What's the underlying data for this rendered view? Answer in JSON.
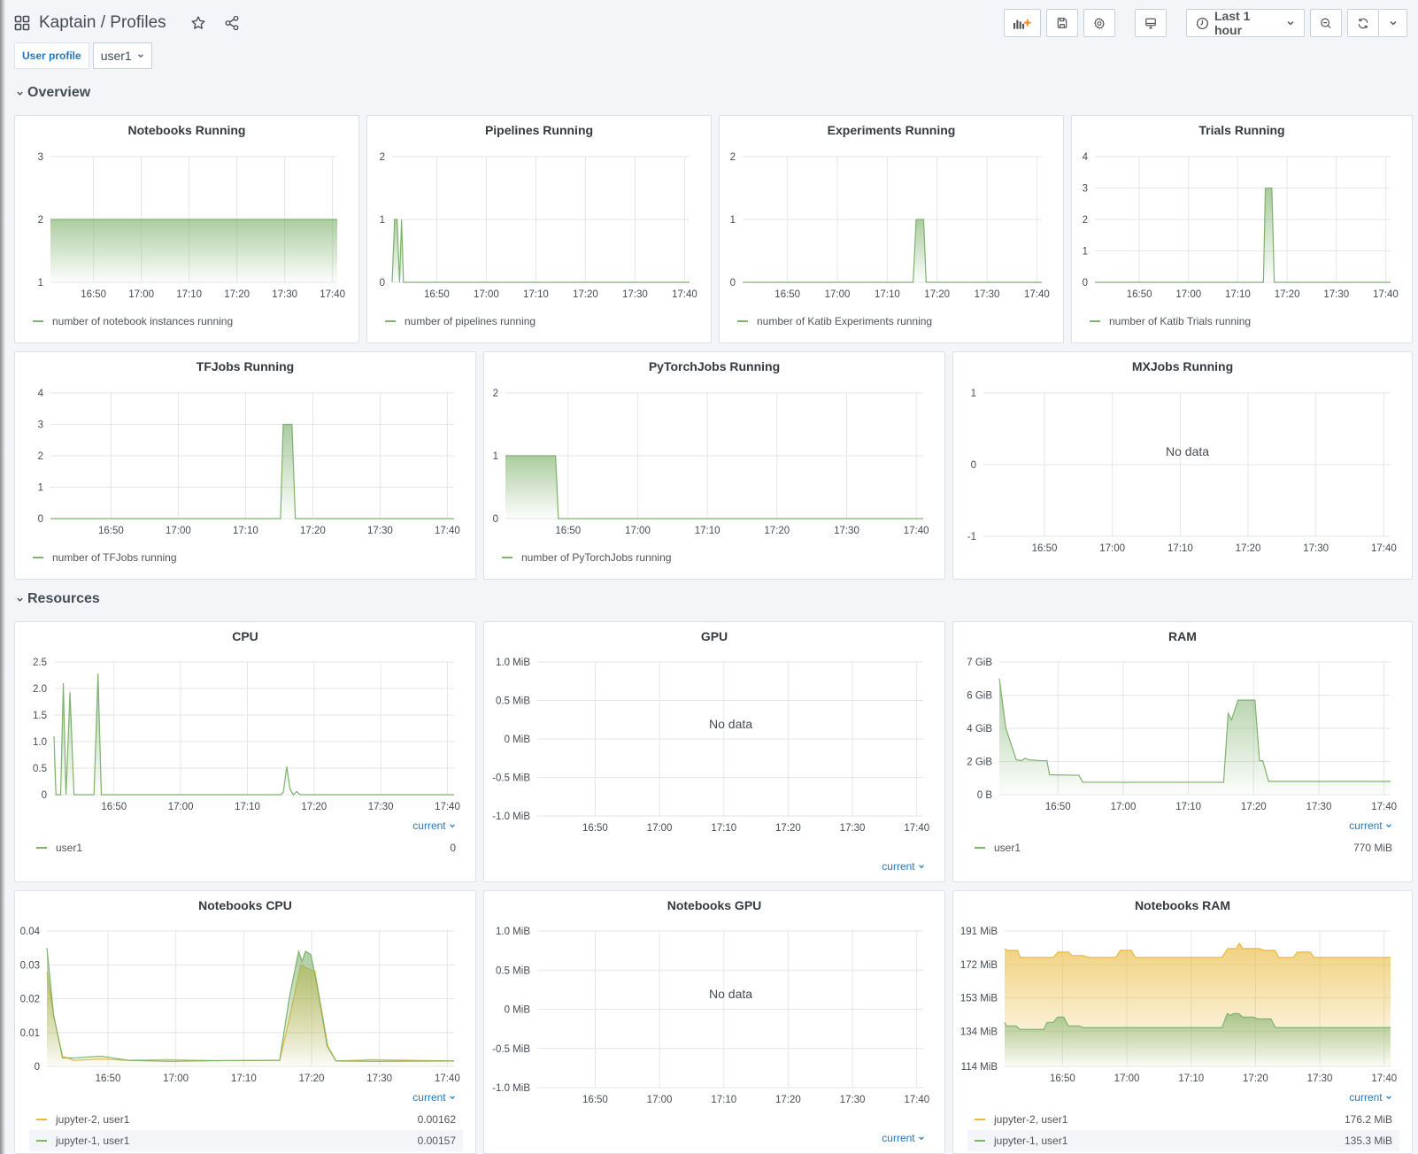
{
  "header": {
    "title": "Kaptain / Profiles",
    "icons": {
      "dashboards": "grid-icon",
      "star": "star-icon",
      "share": "share-icon"
    }
  },
  "toolbar": {
    "add_panel_icon": "add-panel-icon",
    "save_icon": "save-icon",
    "settings_icon": "gear-icon",
    "tv_mode_icon": "monitor-icon",
    "time_range_label": "Last 1 hour",
    "time_range_icon": "clock-icon",
    "zoom_out_icon": "zoom-out-icon",
    "refresh_icon": "refresh-icon",
    "refresh_interval_icon": "chevron-down-icon"
  },
  "variables": {
    "label": "User profile",
    "value": "user1"
  },
  "rows": {
    "overview": "Overview",
    "resources": "Resources"
  },
  "colors": {
    "green": "#7eb26d",
    "yellow": "#eab839",
    "link": "#1f78c1"
  },
  "common": {
    "no_data": "No data",
    "current": "current"
  },
  "chart_data": [
    {
      "id": "notebooks",
      "type": "area",
      "title": "Notebooks Running",
      "xlabel": "",
      "ylabel": "",
      "xlim": [
        "16:41",
        "17:41"
      ],
      "x_ticks": [
        "16:50",
        "17:00",
        "17:10",
        "17:20",
        "17:30",
        "17:40"
      ],
      "ylim": [
        1,
        3
      ],
      "y_ticks": [
        "1",
        "2",
        "3"
      ],
      "grid": true,
      "legend_position": "bottom-left",
      "series": [
        {
          "name": "number of notebook instances running",
          "color": "#7eb26d",
          "points": [
            [
              0,
              2
            ],
            [
              60,
              2
            ]
          ]
        }
      ]
    },
    {
      "id": "pipelines",
      "type": "area",
      "title": "Pipelines Running",
      "xlim": [
        "16:41",
        "17:41"
      ],
      "x_ticks": [
        "16:50",
        "17:00",
        "17:10",
        "17:20",
        "17:30",
        "17:40"
      ],
      "ylim": [
        0,
        2
      ],
      "y_ticks": [
        "0",
        "1",
        "2"
      ],
      "grid": true,
      "legend_position": "bottom-left",
      "series": [
        {
          "name": "number of pipelines running",
          "color": "#7eb26d",
          "points": [
            [
              0,
              0
            ],
            [
              0.5,
              1
            ],
            [
              1,
              1
            ],
            [
              1.5,
              0
            ],
            [
              1.9,
              1
            ],
            [
              2.3,
              0
            ],
            [
              60,
              0
            ]
          ]
        }
      ]
    },
    {
      "id": "experiments",
      "type": "area",
      "title": "Experiments Running",
      "xlim": [
        "16:41",
        "17:41"
      ],
      "x_ticks": [
        "16:50",
        "17:00",
        "17:10",
        "17:20",
        "17:30",
        "17:40"
      ],
      "ylim": [
        0,
        2
      ],
      "y_ticks": [
        "0",
        "1",
        "2"
      ],
      "grid": true,
      "legend_position": "bottom-left",
      "series": [
        {
          "name": "number of Katib Experiments running",
          "color": "#7eb26d",
          "points": [
            [
              0,
              0
            ],
            [
              34.2,
              0
            ],
            [
              34.8,
              1
            ],
            [
              36.3,
              1
            ],
            [
              36.8,
              0
            ],
            [
              60,
              0
            ]
          ]
        }
      ]
    },
    {
      "id": "trials",
      "type": "area",
      "title": "Trials Running",
      "xlim": [
        "16:41",
        "17:41"
      ],
      "x_ticks": [
        "16:50",
        "17:00",
        "17:10",
        "17:20",
        "17:30",
        "17:40"
      ],
      "ylim": [
        0,
        4
      ],
      "y_ticks": [
        "0",
        "1",
        "2",
        "3",
        "4"
      ],
      "grid": true,
      "legend_position": "bottom-left",
      "series": [
        {
          "name": "number of Katib Trials running",
          "color": "#7eb26d",
          "points": [
            [
              0,
              0
            ],
            [
              34.2,
              0
            ],
            [
              34.6,
              3
            ],
            [
              35.9,
              3
            ],
            [
              36.4,
              0
            ],
            [
              60,
              0
            ]
          ]
        }
      ]
    },
    {
      "id": "tfjobs",
      "type": "area",
      "title": "TFJobs Running",
      "xlim": [
        "16:41",
        "17:41"
      ],
      "x_ticks": [
        "16:50",
        "17:00",
        "17:10",
        "17:20",
        "17:30",
        "17:40"
      ],
      "ylim": [
        0,
        4
      ],
      "y_ticks": [
        "0",
        "1",
        "2",
        "3",
        "4"
      ],
      "grid": true,
      "legend_position": "bottom-left",
      "series": [
        {
          "name": "number of TFJobs running",
          "color": "#7eb26d",
          "points": [
            [
              0,
              0
            ],
            [
              34.2,
              0
            ],
            [
              34.6,
              3
            ],
            [
              35.9,
              3
            ],
            [
              36.4,
              0
            ],
            [
              60,
              0
            ]
          ]
        }
      ]
    },
    {
      "id": "pytorch",
      "type": "area",
      "title": "PyTorchJobs Running",
      "xlim": [
        "16:41",
        "17:41"
      ],
      "x_ticks": [
        "16:50",
        "17:00",
        "17:10",
        "17:20",
        "17:30",
        "17:40"
      ],
      "ylim": [
        0,
        2
      ],
      "y_ticks": [
        "0",
        "1",
        "2"
      ],
      "grid": true,
      "legend_position": "bottom-left",
      "series": [
        {
          "name": "number of PyTorchJobs running",
          "color": "#7eb26d",
          "points": [
            [
              0,
              1
            ],
            [
              7.2,
              1
            ],
            [
              7.6,
              0
            ],
            [
              60,
              0
            ]
          ]
        }
      ]
    },
    {
      "id": "mxjobs",
      "type": "area",
      "title": "MXJobs Running",
      "xlim": [
        "16:41",
        "17:41"
      ],
      "x_ticks": [
        "16:50",
        "17:00",
        "17:10",
        "17:20",
        "17:30",
        "17:40"
      ],
      "ylim": [
        -1,
        1
      ],
      "y_ticks": [
        "-1",
        "0",
        "1"
      ],
      "grid": true,
      "no_data": true,
      "series": []
    },
    {
      "id": "cpu",
      "type": "area",
      "title": "CPU",
      "xlim": [
        "16:41",
        "17:41"
      ],
      "x_ticks": [
        "16:50",
        "17:00",
        "17:10",
        "17:20",
        "17:30",
        "17:40"
      ],
      "ylim": [
        0,
        2.5
      ],
      "y_ticks": [
        "0",
        "0.5",
        "1.0",
        "1.5",
        "2.0",
        "2.5"
      ],
      "grid": true,
      "legend_position": "bottom",
      "series": [
        {
          "name": "user1",
          "color": "#7eb26d",
          "current": "0",
          "points": [
            [
              0,
              1.1
            ],
            [
              0.3,
              0
            ],
            [
              1.0,
              0
            ],
            [
              1.4,
              2.1
            ],
            [
              1.8,
              0
            ],
            [
              2.4,
              1.93
            ],
            [
              3.0,
              0
            ],
            [
              6.0,
              0
            ],
            [
              6.6,
              2.28
            ],
            [
              7.1,
              0
            ],
            [
              34.0,
              0
            ],
            [
              34.4,
              0.05
            ],
            [
              34.9,
              0.53
            ],
            [
              35.4,
              0.1
            ],
            [
              35.9,
              0
            ],
            [
              36.4,
              0.06
            ],
            [
              36.9,
              0
            ],
            [
              60,
              0
            ]
          ]
        }
      ]
    },
    {
      "id": "gpu",
      "type": "area",
      "title": "GPU",
      "xlim": [
        "16:41",
        "17:41"
      ],
      "x_ticks": [
        "16:50",
        "17:00",
        "17:10",
        "17:20",
        "17:30",
        "17:40"
      ],
      "ylim": [
        -1,
        1
      ],
      "y_ticks": [
        "-1.0 MiB",
        "-0.5 MiB",
        "0 MiB",
        "0.5 MiB",
        "1.0 MiB"
      ],
      "grid": true,
      "no_data": true,
      "series": []
    },
    {
      "id": "ram",
      "type": "area",
      "title": "RAM",
      "xlim": [
        "16:41",
        "17:41"
      ],
      "x_ticks": [
        "16:50",
        "17:00",
        "17:10",
        "17:20",
        "17:30",
        "17:40"
      ],
      "ylim": [
        0,
        8
      ],
      "y_ticks": [
        "0 B",
        "2 GiB",
        "4 GiB",
        "6 GiB",
        "7 GiB"
      ],
      "y_tick_values": [
        0,
        2,
        4,
        6,
        8
      ],
      "grid": true,
      "legend_position": "bottom",
      "series": [
        {
          "name": "user1",
          "color": "#7eb26d",
          "current": "770 MiB",
          "points": [
            [
              0,
              7.0
            ],
            [
              1.0,
              4.0
            ],
            [
              2.6,
              2.1
            ],
            [
              3.4,
              2.05
            ],
            [
              4.0,
              2.2
            ],
            [
              4.5,
              2.1
            ],
            [
              6.5,
              2.05
            ],
            [
              7.3,
              2.05
            ],
            [
              7.7,
              1.2
            ],
            [
              12.2,
              1.17
            ],
            [
              12.8,
              0.75
            ],
            [
              34.4,
              0.75
            ],
            [
              35.1,
              4.9
            ],
            [
              35.6,
              4.5
            ],
            [
              36.6,
              5.7
            ],
            [
              39.2,
              5.7
            ],
            [
              39.9,
              2.05
            ],
            [
              40.4,
              2.05
            ],
            [
              41.3,
              0.8
            ],
            [
              60,
              0.8
            ]
          ]
        }
      ]
    },
    {
      "id": "nb_cpu",
      "type": "area",
      "title": "Notebooks CPU",
      "xlim": [
        "16:41",
        "17:41"
      ],
      "x_ticks": [
        "16:50",
        "17:00",
        "17:10",
        "17:20",
        "17:30",
        "17:40"
      ],
      "ylim": [
        0,
        0.04
      ],
      "y_ticks": [
        "0",
        "0.01",
        "0.02",
        "0.03",
        "0.04"
      ],
      "grid": true,
      "legend_position": "bottom",
      "series": [
        {
          "name": "jupyter-2, user1",
          "color": "#eab839",
          "current": "0.00162",
          "points": [
            [
              0,
              0.028
            ],
            [
              1.0,
              0.015
            ],
            [
              2.3,
              0.003
            ],
            [
              4,
              0.0018
            ],
            [
              8,
              0.0022
            ],
            [
              12,
              0.0018
            ],
            [
              18,
              0.002
            ],
            [
              25,
              0.0017
            ],
            [
              34.3,
              0.0018
            ],
            [
              35.6,
              0.013
            ],
            [
              37.4,
              0.03
            ],
            [
              39.5,
              0.028
            ],
            [
              41.4,
              0.006
            ],
            [
              42.6,
              0.0016
            ],
            [
              48,
              0.002
            ],
            [
              60,
              0.0016
            ]
          ]
        },
        {
          "name": "jupyter-1, user1",
          "color": "#7eb26d",
          "current": "0.00157",
          "points": [
            [
              0,
              0.035
            ],
            [
              1.0,
              0.015
            ],
            [
              2.3,
              0.0025
            ],
            [
              4,
              0.0025
            ],
            [
              8,
              0.003
            ],
            [
              12,
              0.0018
            ],
            [
              18,
              0.0015
            ],
            [
              25,
              0.0017
            ],
            [
              34.3,
              0.0018
            ],
            [
              35.7,
              0.02
            ],
            [
              37.1,
              0.034
            ],
            [
              37.6,
              0.031
            ],
            [
              38.1,
              0.034
            ],
            [
              38.9,
              0.033
            ],
            [
              39.8,
              0.024
            ],
            [
              41.3,
              0.006
            ],
            [
              42.6,
              0.0016
            ],
            [
              48,
              0.0015
            ],
            [
              60,
              0.0016
            ]
          ]
        }
      ]
    },
    {
      "id": "nb_gpu",
      "type": "area",
      "title": "Notebooks GPU",
      "xlim": [
        "16:41",
        "17:41"
      ],
      "x_ticks": [
        "16:50",
        "17:00",
        "17:10",
        "17:20",
        "17:30",
        "17:40"
      ],
      "ylim": [
        -1,
        1
      ],
      "y_ticks": [
        "-1.0 MiB",
        "-0.5 MiB",
        "0 MiB",
        "0.5 MiB",
        "1.0 MiB"
      ],
      "grid": true,
      "no_data": true,
      "series": []
    },
    {
      "id": "nb_ram",
      "type": "area",
      "title": "Notebooks RAM",
      "xlim": [
        "16:41",
        "17:41"
      ],
      "x_ticks": [
        "16:50",
        "17:00",
        "17:10",
        "17:20",
        "17:30",
        "17:40"
      ],
      "ylim": [
        114,
        191
      ],
      "y_ticks": [
        "114 MiB",
        "134 MiB",
        "153 MiB",
        "172 MiB",
        "191 MiB"
      ],
      "y_tick_values": [
        114,
        134,
        153,
        172,
        191
      ],
      "grid": true,
      "legend_position": "bottom",
      "series": [
        {
          "name": "jupyter-2, user1",
          "color": "#eab839",
          "current": "176.2 MiB",
          "points": [
            [
              0,
              181
            ],
            [
              0.4,
              180
            ],
            [
              2,
              180
            ],
            [
              2.4,
              176
            ],
            [
              7.6,
              176
            ],
            [
              8.3,
              179
            ],
            [
              9.9,
              179
            ],
            [
              10.5,
              177
            ],
            [
              12.2,
              177
            ],
            [
              13,
              176
            ],
            [
              17.3,
              176
            ],
            [
              18,
              180
            ],
            [
              19.7,
              180
            ],
            [
              20.3,
              176
            ],
            [
              33.8,
              176
            ],
            [
              34.7,
              181
            ],
            [
              36.0,
              181
            ],
            [
              36.5,
              184
            ],
            [
              37.0,
              181
            ],
            [
              39.6,
              181
            ],
            [
              40.3,
              180
            ],
            [
              42,
              180
            ],
            [
              42.6,
              176
            ],
            [
              44.9,
              176
            ],
            [
              45.5,
              179
            ],
            [
              47.5,
              179
            ],
            [
              48.1,
              176
            ],
            [
              60,
              176
            ]
          ]
        },
        {
          "name": "jupyter-1, user1",
          "color": "#7eb26d",
          "current": "135.3 MiB",
          "points": [
            [
              0,
              139
            ],
            [
              0.3,
              137
            ],
            [
              1.8,
              137
            ],
            [
              2.4,
              135
            ],
            [
              6.1,
              135
            ],
            [
              6.6,
              139
            ],
            [
              7.6,
              139
            ],
            [
              8.2,
              142
            ],
            [
              9.2,
              142
            ],
            [
              9.9,
              137
            ],
            [
              11.6,
              137
            ],
            [
              12.2,
              136
            ],
            [
              33.8,
              136
            ],
            [
              34.6,
              144
            ],
            [
              35.1,
              143
            ],
            [
              35.6,
              144
            ],
            [
              36.4,
              144
            ],
            [
              37.0,
              142
            ],
            [
              38.7,
              142
            ],
            [
              39.4,
              141
            ],
            [
              41.4,
              141
            ],
            [
              42.1,
              136
            ],
            [
              60,
              136
            ]
          ]
        }
      ]
    }
  ]
}
